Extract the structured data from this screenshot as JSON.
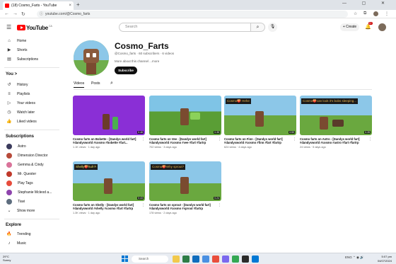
{
  "browser": {
    "tab_title": "(18) Cosmo_Farts - YouTube",
    "tab_close": "×",
    "new_tab": "+",
    "window_controls": "—  ▢  ✕",
    "url": "youtube.com/@Cosmo_farts"
  },
  "youtube": {
    "logo_text": "YouTube",
    "country_code": "CA",
    "search_placeholder": "Search",
    "create_label": "+ Create",
    "notifications_count": "9+"
  },
  "sidebar": {
    "main": [
      {
        "label": "Home",
        "icon": "home-icon",
        "glyph": "⌂"
      },
      {
        "label": "Shorts",
        "icon": "shorts-icon",
        "glyph": "▶"
      },
      {
        "label": "Subscriptions",
        "icon": "subscriptions-icon",
        "glyph": "▤"
      }
    ],
    "you_heading": "You",
    "you_chevron": ">",
    "you": [
      {
        "label": "History",
        "icon": "history-icon",
        "glyph": "↺"
      },
      {
        "label": "Playlists",
        "icon": "playlists-icon",
        "glyph": "≡"
      },
      {
        "label": "Your videos",
        "icon": "your-videos-icon",
        "glyph": "▷"
      },
      {
        "label": "Watch later",
        "icon": "watch-later-icon",
        "glyph": "◷"
      },
      {
        "label": "Liked videos",
        "icon": "liked-videos-icon",
        "glyph": "👍"
      }
    ],
    "subscriptions_heading": "Subscriptions",
    "subscriptions": [
      {
        "label": "Astro",
        "color": "#3b3b5c"
      },
      {
        "label": "Dimension Director",
        "color": "#b74a3a"
      },
      {
        "label": "Gemma & Cindy",
        "color": "#d9739a"
      },
      {
        "label": "Mr. Quester",
        "color": "#c0392b"
      },
      {
        "label": "Play Tags",
        "color": "#e74c3c"
      },
      {
        "label": "Stephanie Mcleod a...",
        "color": "#8e44ad"
      },
      {
        "label": "Tiavi",
        "color": "#5d6d7e"
      }
    ],
    "show_more": "Show more",
    "explore_heading": "Explore",
    "explore": [
      {
        "label": "Trending",
        "icon": "trending-icon",
        "glyph": "🔥"
      },
      {
        "label": "Music",
        "icon": "music-icon",
        "glyph": "♪"
      }
    ]
  },
  "channel": {
    "name": "Cosmo_Farts",
    "meta": "@Cosmo_farts · 60 subscribers · 6 videos",
    "description": "More about this channel ...more",
    "subscribe_label": "Subscribe",
    "tabs": [
      "Videos",
      "Posts"
    ],
    "search_glyph": "⌕"
  },
  "videos": [
    {
      "title": "Cosmo farts on Bobette - [Dandys world fart] #dandysworld #cosmo #bobette #fart...",
      "meta": "1.1K views · 1 day ago",
      "duration": "0:48",
      "caption": "",
      "bg": "#8a2fd6",
      "ground": "#8a2fd6"
    },
    {
      "title": "Cosmo farts on Vee - [Dandys world fart] #dandysworld #cosmo #vee #fart #fartrp",
      "meta": "702 views · 3 days ago",
      "duration": "0:35",
      "caption": "",
      "bg": "#6aa83f",
      "ground": "#4f8f2b"
    },
    {
      "title": "Cosmo farts on Finn - [Dandys world fart] #dandysworld #cosmo #finn #fart #fartrp",
      "meta": "624 views · 4 days ago",
      "duration": "0:59",
      "caption": "Cosmo🍑 Hehe",
      "bg": "#8cc7e8",
      "ground": "#6aa83f"
    },
    {
      "title": "Cosmo farts on Astro - [Dandys world fart] #dandysworld #cosmo #astro #fart #fartrp",
      "meta": "24 views · 5 days ago",
      "duration": "0:28",
      "caption": "Cosmo🍑can look it's bobs sleeping...",
      "bg": "#8cc7e8",
      "ground": "#6aa83f"
    },
    {
      "title": "Cosmo farts on Shelly - [Dandys world fart] #dandysworld #shelly #cosmo #fart #fartrp",
      "meta": "1.3K views · 1 day ago",
      "duration": "0:43",
      "caption": "Shelly🍑huh?!",
      "bg": "#8cc7e8",
      "ground": "#6aa83f"
    },
    {
      "title": "Cosmo farts on sprout - [Dandys world fart] #dandysworld #cosmo #sprout #fartrp",
      "meta": "178 views · 2 days ago",
      "duration": "0:24",
      "caption": "Cosmo🍑Why sprout?",
      "bg": "#8cc7e8",
      "ground": "#6aa83f"
    }
  ],
  "taskbar": {
    "weather_temp": "29°C",
    "weather_desc": "Sunny",
    "search_label": "Search",
    "tray": "ENG  ⌃  ◉  🔊",
    "time": "5:07 pm",
    "date": "04/07/2024"
  }
}
